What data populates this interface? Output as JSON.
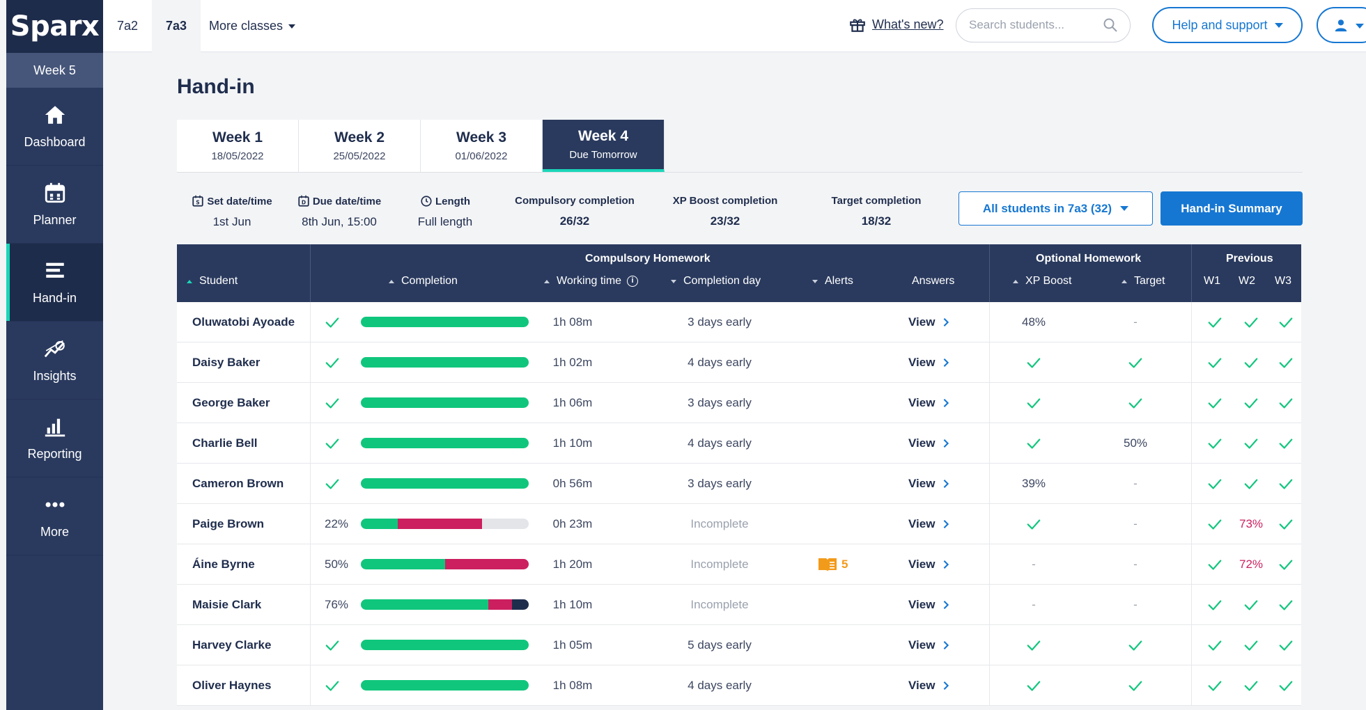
{
  "app": {
    "logo": "Sparx",
    "current_week": "Week 5"
  },
  "nav": [
    {
      "label": "Dashboard",
      "icon": "home-icon"
    },
    {
      "label": "Planner",
      "icon": "calendar-icon"
    },
    {
      "label": "Hand-in",
      "icon": "list-icon"
    },
    {
      "label": "Insights",
      "icon": "insights-icon"
    },
    {
      "label": "Reporting",
      "icon": "bar-chart-icon"
    },
    {
      "label": "More",
      "icon": "more-dots-icon"
    }
  ],
  "topbar": {
    "class_tabs": [
      "7a2",
      "7a3"
    ],
    "more_classes": "More classes",
    "whats_new": "What's new?",
    "search_placeholder": "Search students...",
    "help": "Help and support"
  },
  "page": {
    "title": "Hand-in"
  },
  "week_tabs": [
    {
      "title": "Week 1",
      "sub": "18/05/2022"
    },
    {
      "title": "Week 2",
      "sub": "25/05/2022"
    },
    {
      "title": "Week 3",
      "sub": "01/06/2022"
    },
    {
      "title": "Week 4",
      "sub": "Due Tomorrow"
    }
  ],
  "info": {
    "set_label": "Set date/time",
    "set_value": "1st Jun",
    "due_label": "Due date/time",
    "due_value": "8th Jun, 15:00",
    "length_label": "Length",
    "length_value": "Full length",
    "compulsory_label": "Compulsory completion",
    "compulsory_value": "26/32",
    "xp_label": "XP Boost completion",
    "xp_value": "23/32",
    "target_label": "Target completion",
    "target_value": "18/32"
  },
  "buttons": {
    "students_filter": "All students in 7a3 (32)",
    "summary": "Hand-in Summary"
  },
  "table": {
    "groups": {
      "compulsory": "Compulsory Homework",
      "optional": "Optional Homework",
      "previous": "Previous"
    },
    "columns": {
      "student": "Student",
      "completion": "Completion",
      "working_time": "Working time",
      "completion_day": "Completion day",
      "alerts": "Alerts",
      "answers": "Answers",
      "xp_boost": "XP Boost",
      "target": "Target",
      "w1": "W1",
      "w2": "W2",
      "w3": "W3"
    },
    "view_label": "View",
    "rows": [
      {
        "name": "Oluwatobi Ayoade",
        "completion": "✓",
        "bar": {
          "green": 1,
          "red": 0,
          "navy": 0
        },
        "time": "1h 08m",
        "day": "3 days early",
        "alert": "",
        "xp": "48%",
        "target": "-",
        "w1": "✓",
        "w2": "✓",
        "w3": "✓"
      },
      {
        "name": "Daisy Baker",
        "completion": "✓",
        "bar": {
          "green": 1,
          "red": 0,
          "navy": 0
        },
        "time": "1h 02m",
        "day": "4 days early",
        "alert": "",
        "xp": "✓",
        "target": "✓",
        "w1": "✓",
        "w2": "✓",
        "w3": "✓"
      },
      {
        "name": "George Baker",
        "completion": "✓",
        "bar": {
          "green": 1,
          "red": 0,
          "navy": 0
        },
        "time": "1h 06m",
        "day": "3 days early",
        "alert": "",
        "xp": "✓",
        "target": "✓",
        "w1": "✓",
        "w2": "✓",
        "w3": "✓"
      },
      {
        "name": "Charlie Bell",
        "completion": "✓",
        "bar": {
          "green": 1,
          "red": 0,
          "navy": 0
        },
        "time": "1h 10m",
        "day": "4 days early",
        "alert": "",
        "xp": "✓",
        "target": "50%",
        "w1": "✓",
        "w2": "✓",
        "w3": "✓"
      },
      {
        "name": "Cameron Brown",
        "completion": "✓",
        "bar": {
          "green": 1,
          "red": 0,
          "navy": 0
        },
        "time": "0h 56m",
        "day": "3 days early",
        "alert": "",
        "xp": "39%",
        "target": "-",
        "w1": "✓",
        "w2": "✓",
        "w3": "✓"
      },
      {
        "name": "Paige Brown",
        "completion": "22%",
        "bar": {
          "green": 0.22,
          "red": 0.5,
          "navy": 0
        },
        "time": "0h 23m",
        "day": "Incomplete",
        "alert": "",
        "xp": "✓",
        "target": "-",
        "w1": "✓",
        "w2": "73%",
        "w3": "✓"
      },
      {
        "name": "Áine Byrne",
        "completion": "50%",
        "bar": {
          "green": 0.5,
          "red": 0.5,
          "navy": 0
        },
        "time": "1h 20m",
        "day": "Incomplete",
        "alert": "5",
        "xp": "-",
        "target": "-",
        "w1": "✓",
        "w2": "72%",
        "w3": "✓"
      },
      {
        "name": "Maisie Clark",
        "completion": "76%",
        "bar": {
          "green": 0.76,
          "red": 0.14,
          "navy": 0.1
        },
        "time": "1h 10m",
        "day": "Incomplete",
        "alert": "",
        "xp": "-",
        "target": "-",
        "w1": "✓",
        "w2": "✓",
        "w3": "✓"
      },
      {
        "name": "Harvey Clarke",
        "completion": "✓",
        "bar": {
          "green": 1,
          "red": 0,
          "navy": 0
        },
        "time": "1h 05m",
        "day": "5 days early",
        "alert": "",
        "xp": "✓",
        "target": "✓",
        "w1": "✓",
        "w2": "✓",
        "w3": "✓"
      },
      {
        "name": "Oliver Haynes",
        "completion": "✓",
        "bar": {
          "green": 1,
          "red": 0,
          "navy": 0
        },
        "time": "1h 08m",
        "day": "4 days early",
        "alert": "",
        "xp": "✓",
        "target": "✓",
        "w1": "✓",
        "w2": "✓",
        "w3": "✓"
      }
    ]
  },
  "colors": {
    "navy": "#2a3a5e",
    "accent": "#1ad6b9",
    "blue": "#1677d2",
    "green": "#10c67d",
    "red": "#cc1f5f",
    "orange": "#f29a1a"
  }
}
